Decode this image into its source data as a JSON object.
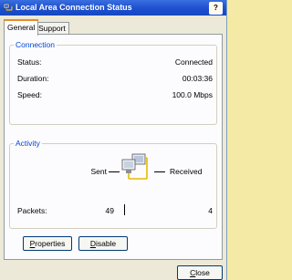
{
  "window": {
    "title": "Local Area Connection Status",
    "help_label": "?"
  },
  "tabs": [
    {
      "label": "General",
      "selected": true
    },
    {
      "label": "Support",
      "selected": false
    }
  ],
  "connection": {
    "group_title": "Connection",
    "status_label": "Status:",
    "status_value": "Connected",
    "duration_label": "Duration:",
    "duration_value": "00:03:36",
    "speed_label": "Speed:",
    "speed_value": "100.0 Mbps"
  },
  "activity": {
    "group_title": "Activity",
    "sent_label": "Sent",
    "received_label": "Received",
    "packets_label": "Packets:",
    "packets_sent": "49",
    "packets_received": "4"
  },
  "buttons": {
    "properties": {
      "first": "P",
      "rest": "roperties"
    },
    "disable": {
      "first": "D",
      "rest": "isable"
    },
    "close": {
      "first": "C",
      "rest": "lose"
    }
  },
  "colors": {
    "titlebar": "#1d4fcf",
    "group_title": "#0046d5",
    "tab_highlight": "#e68b2c",
    "background_ribbon": "#f5e9a6"
  },
  "icons": {
    "title": "network-connection-icon",
    "activity": "network-computers-icon"
  }
}
